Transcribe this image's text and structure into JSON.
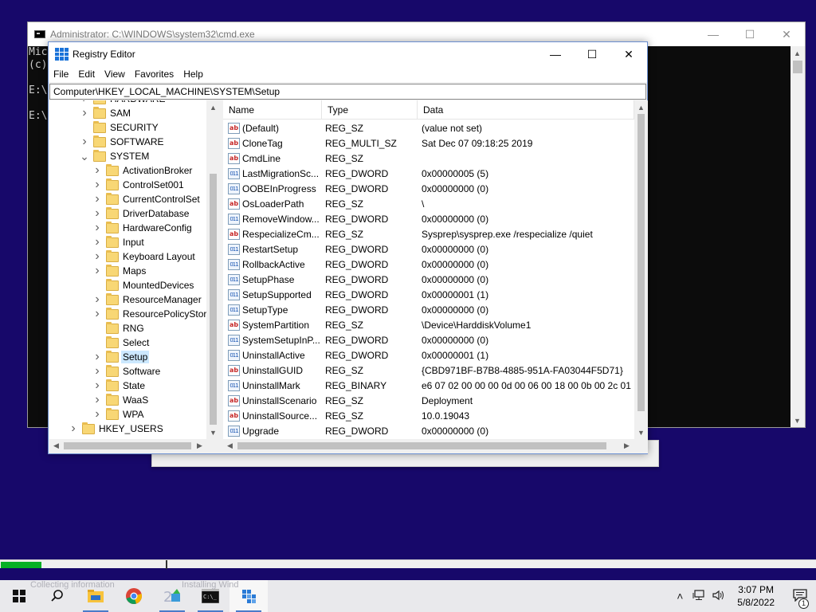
{
  "cmd": {
    "title": "Administrator: C:\\WINDOWS\\system32\\cmd.exe",
    "lines": [
      "Mic",
      "(c)",
      "",
      "E:\\",
      "",
      "E:\\"
    ]
  },
  "regedit": {
    "title": "Registry Editor",
    "menu": [
      "File",
      "Edit",
      "View",
      "Favorites",
      "Help"
    ],
    "address": "Computer\\HKEY_LOCAL_MACHINE\\SYSTEM\\Setup",
    "tree": [
      {
        "label": "HARDWARE",
        "level": 1,
        "expander": "collapsed"
      },
      {
        "label": "SAM",
        "level": 1,
        "expander": "collapsed"
      },
      {
        "label": "SECURITY",
        "level": 1,
        "expander": "none"
      },
      {
        "label": "SOFTWARE",
        "level": 1,
        "expander": "collapsed"
      },
      {
        "label": "SYSTEM",
        "level": 1,
        "expander": "expanded"
      },
      {
        "label": "ActivationBroker",
        "level": 2,
        "expander": "collapsed"
      },
      {
        "label": "ControlSet001",
        "level": 2,
        "expander": "collapsed"
      },
      {
        "label": "CurrentControlSet",
        "level": 2,
        "expander": "collapsed"
      },
      {
        "label": "DriverDatabase",
        "level": 2,
        "expander": "collapsed"
      },
      {
        "label": "HardwareConfig",
        "level": 2,
        "expander": "collapsed"
      },
      {
        "label": "Input",
        "level": 2,
        "expander": "collapsed"
      },
      {
        "label": "Keyboard Layout",
        "level": 2,
        "expander": "collapsed"
      },
      {
        "label": "Maps",
        "level": 2,
        "expander": "collapsed"
      },
      {
        "label": "MountedDevices",
        "level": 2,
        "expander": "none"
      },
      {
        "label": "ResourceManager",
        "level": 2,
        "expander": "collapsed"
      },
      {
        "label": "ResourcePolicyStore",
        "level": 2,
        "expander": "collapsed"
      },
      {
        "label": "RNG",
        "level": 2,
        "expander": "none"
      },
      {
        "label": "Select",
        "level": 2,
        "expander": "none"
      },
      {
        "label": "Setup",
        "level": 2,
        "expander": "collapsed",
        "selected": true
      },
      {
        "label": "Software",
        "level": 2,
        "expander": "collapsed"
      },
      {
        "label": "State",
        "level": 2,
        "expander": "collapsed"
      },
      {
        "label": "WaaS",
        "level": 2,
        "expander": "collapsed"
      },
      {
        "label": "WPA",
        "level": 2,
        "expander": "collapsed"
      },
      {
        "label": "HKEY_USERS",
        "level": 0,
        "expander": "collapsed"
      }
    ],
    "columns": [
      "Name",
      "Type",
      "Data"
    ],
    "values": [
      {
        "icon": "string",
        "name": "(Default)",
        "type": "REG_SZ",
        "data": "(value not set)"
      },
      {
        "icon": "string",
        "name": "CloneTag",
        "type": "REG_MULTI_SZ",
        "data": "Sat Dec 07 09:18:25 2019"
      },
      {
        "icon": "string",
        "name": "CmdLine",
        "type": "REG_SZ",
        "data": ""
      },
      {
        "icon": "binary",
        "name": "LastMigrationSc...",
        "type": "REG_DWORD",
        "data": "0x00000005 (5)"
      },
      {
        "icon": "binary",
        "name": "OOBEInProgress",
        "type": "REG_DWORD",
        "data": "0x00000000 (0)"
      },
      {
        "icon": "string",
        "name": "OsLoaderPath",
        "type": "REG_SZ",
        "data": "\\"
      },
      {
        "icon": "binary",
        "name": "RemoveWindow...",
        "type": "REG_DWORD",
        "data": "0x00000000 (0)"
      },
      {
        "icon": "string",
        "name": "RespecializeCm...",
        "type": "REG_SZ",
        "data": "Sysprep\\sysprep.exe /respecialize /quiet"
      },
      {
        "icon": "binary",
        "name": "RestartSetup",
        "type": "REG_DWORD",
        "data": "0x00000000 (0)"
      },
      {
        "icon": "binary",
        "name": "RollbackActive",
        "type": "REG_DWORD",
        "data": "0x00000000 (0)"
      },
      {
        "icon": "binary",
        "name": "SetupPhase",
        "type": "REG_DWORD",
        "data": "0x00000000 (0)"
      },
      {
        "icon": "binary",
        "name": "SetupSupported",
        "type": "REG_DWORD",
        "data": "0x00000001 (1)"
      },
      {
        "icon": "binary",
        "name": "SetupType",
        "type": "REG_DWORD",
        "data": "0x00000000 (0)"
      },
      {
        "icon": "string",
        "name": "SystemPartition",
        "type": "REG_SZ",
        "data": "\\Device\\HarddiskVolume1"
      },
      {
        "icon": "binary",
        "name": "SystemSetupInP...",
        "type": "REG_DWORD",
        "data": "0x00000000 (0)"
      },
      {
        "icon": "binary",
        "name": "UninstallActive",
        "type": "REG_DWORD",
        "data": "0x00000001 (1)"
      },
      {
        "icon": "string",
        "name": "UninstallGUID",
        "type": "REG_SZ",
        "data": "{CBD971BF-B7B8-4885-951A-FA03044F5D71}"
      },
      {
        "icon": "binary",
        "name": "UninstallMark",
        "type": "REG_BINARY",
        "data": "e6 07 02 00 00 00 0d 00 06 00 18 00 0b 00 2c 01"
      },
      {
        "icon": "string",
        "name": "UninstallScenario",
        "type": "REG_SZ",
        "data": "Deployment"
      },
      {
        "icon": "string",
        "name": "UninstallSource...",
        "type": "REG_SZ",
        "data": "10.0.19043"
      },
      {
        "icon": "binary",
        "name": "Upgrade",
        "type": "REG_DWORD",
        "data": "0x00000000 (0)"
      }
    ],
    "icon_text": {
      "string": "ab",
      "binary": "011"
    }
  },
  "setup_progress": {
    "fraction": 0.05
  },
  "background_text": {
    "left": "Collecting information",
    "right": "Installing Wind"
  },
  "taskbar": {
    "apps": [
      "windows-start-icon",
      "search-icon",
      "file-explorer-icon",
      "chrome-icon",
      "setup-icon",
      "cmd-icon",
      "regedit-icon"
    ],
    "time": "3:07 PM",
    "date": "5/8/2022",
    "notification_count": "1"
  },
  "colors": {
    "desktop": "#17086a",
    "progress": "#06b025",
    "selection": "#cce8ff"
  }
}
